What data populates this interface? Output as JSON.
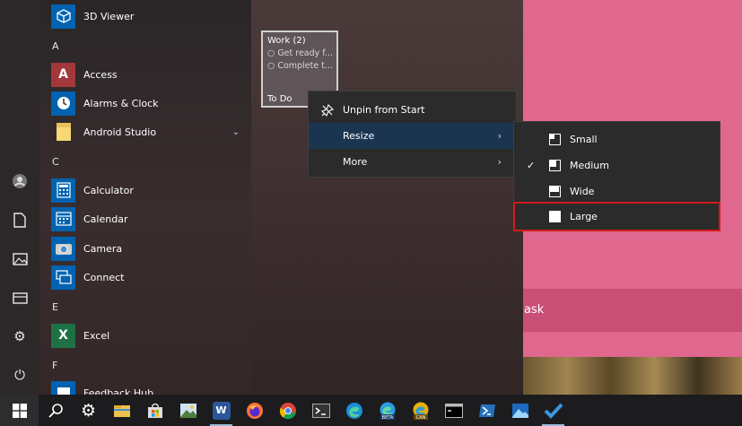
{
  "start_menu": {
    "apps": [
      {
        "label": "3D Viewer",
        "icon": "cube-icon",
        "color": "#0063b1"
      },
      {
        "label": "Access",
        "icon": "access-icon",
        "color": "#a4373a"
      },
      {
        "label": "Alarms & Clock",
        "icon": "clock-icon",
        "color": "#0063b1"
      },
      {
        "label": "Android Studio",
        "icon": "folder-icon",
        "color": "#f8d775"
      },
      {
        "label": "Calculator",
        "icon": "calculator-icon",
        "color": "#0063b1"
      },
      {
        "label": "Calendar",
        "icon": "calendar-icon",
        "color": "#0063b1"
      },
      {
        "label": "Camera",
        "icon": "camera-icon",
        "color": "#0063b1"
      },
      {
        "label": "Connect",
        "icon": "connect-icon",
        "color": "#0063b1"
      },
      {
        "label": "Excel",
        "icon": "excel-icon",
        "color": "#1e7145"
      },
      {
        "label": "Feedback Hub",
        "icon": "feedback-icon",
        "color": "#0063b1"
      }
    ],
    "letters": {
      "a": "A",
      "c": "C",
      "e": "E",
      "f": "F"
    },
    "access_glyph": "A",
    "excel_glyph": "X"
  },
  "tile": {
    "title": "Work (2)",
    "items": [
      "Get ready f...",
      "Complete t..."
    ],
    "footer": "To Do"
  },
  "context_menu": {
    "items": [
      {
        "label": "Unpin from Start",
        "icon": "unpin-icon"
      },
      {
        "label": "Resize",
        "submenu": true,
        "highlighted": true
      },
      {
        "label": "More",
        "submenu": true
      }
    ]
  },
  "resize_submenu": {
    "items": [
      {
        "label": "Small",
        "checked": false
      },
      {
        "label": "Medium",
        "checked": true
      },
      {
        "label": "Wide",
        "checked": false
      },
      {
        "label": "Large",
        "checked": false,
        "outlined": true
      }
    ]
  },
  "desktop": {
    "partial_text": "ask",
    "accent": "#e0678d"
  },
  "taskbar": {
    "word_glyph": "W",
    "beta_label": "BETA",
    "can_label": "CAN"
  },
  "colors": {
    "menu_highlight": "#1b3551",
    "outline": "#d11b1b"
  }
}
